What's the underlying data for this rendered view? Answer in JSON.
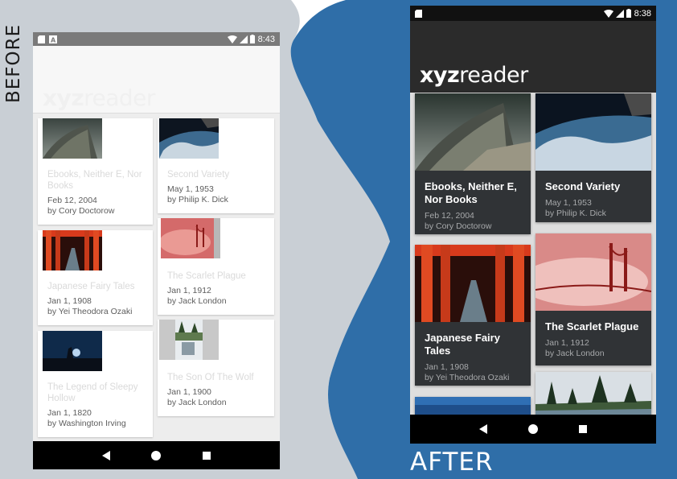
{
  "labels": {
    "before": "BEFORE",
    "after": "AFTER"
  },
  "colors": {
    "before_bg": "#c9cfd5",
    "after_bg": "#2f6ea8",
    "card_dark": "#303336"
  },
  "before": {
    "status_time": "8:43",
    "logo_bold": "xyz",
    "logo_light": "reader",
    "cards": [
      {
        "title_lines": [
          "Ebooks, Neither E, Nor",
          "Books"
        ],
        "date": "Feb 12, 2004",
        "author": "by Cory Doctorow",
        "image": "opera-house"
      },
      {
        "title_lines": [
          "Second Variety"
        ],
        "date": "May 1, 1953",
        "author": "by Philip K. Dick",
        "image": "earth-space"
      },
      {
        "title_lines": [
          "Japanese Fairy Tales"
        ],
        "date": "Jan 1, 1908",
        "author": "by Yei Theodora Ozaki",
        "image": "torii-gates"
      },
      {
        "title_lines": [
          "The Scarlet Plague"
        ],
        "date": "Jan 1, 1912",
        "author": "by Jack London",
        "image": "golden-gate-fog"
      },
      {
        "title_lines": [
          "The Legend of Sleepy",
          "Hollow"
        ],
        "date": "Jan 1, 1820",
        "author": "by Washington Irving",
        "image": "night-figure"
      },
      {
        "title_lines": [
          "The Son Of The Wolf"
        ],
        "date": "Jan 1, 1900",
        "author": "by Jack London",
        "image": "forest-lake"
      }
    ]
  },
  "after": {
    "status_time": "8:38",
    "logo_bold": "xyz",
    "logo_light": "reader",
    "cards": [
      {
        "title_lines": [
          "Ebooks, Neither E,",
          "Nor Books"
        ],
        "date": "Feb 12, 2004",
        "author": "by Cory Doctorow",
        "image": "opera-house"
      },
      {
        "title_lines": [
          "Second Variety"
        ],
        "date": "May 1, 1953",
        "author": "by Philip K. Dick",
        "image": "earth-space"
      },
      {
        "title_lines": [
          "Japanese Fairy",
          "Tales"
        ],
        "date": "Jan 1, 1908",
        "author": "by Yei Theodora Ozaki",
        "image": "torii-gates"
      },
      {
        "title_lines": [
          "The Scarlet Plague"
        ],
        "date": "Jan 1, 1912",
        "author": "by Jack London",
        "image": "golden-gate-fog"
      }
    ]
  }
}
